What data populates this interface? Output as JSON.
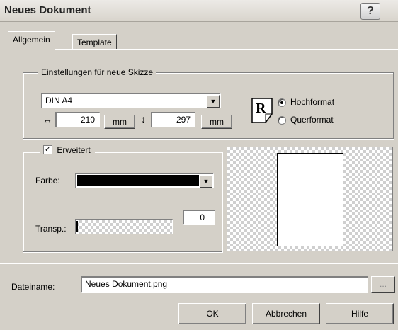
{
  "window": {
    "title": "Neues Dokument"
  },
  "tabs": [
    {
      "label": "Allgemein",
      "active": true
    },
    {
      "label": "Template",
      "active": false
    }
  ],
  "settings": {
    "legend": "Einstellungen für neue Skizze",
    "paper_size": "DIN A4",
    "width_value": "210",
    "width_unit": "mm",
    "height_value": "297",
    "height_unit": "mm",
    "orientation_icon_glyph": "R",
    "orientation": [
      {
        "label": "Hochformat",
        "checked": true
      },
      {
        "label": "Querformat",
        "checked": false
      }
    ]
  },
  "extended": {
    "label": "Erweitert",
    "checked": true,
    "color_label": "Farbe:",
    "color_value": "#000000",
    "transparency_label": "Transp.:",
    "transparency_value": "0"
  },
  "footer": {
    "filename_label": "Dateiname:",
    "filename_value": "Neues Dokument.png",
    "browse_label": "...",
    "ok_label": "OK",
    "cancel_label": "Abbrechen",
    "help_label": "Hilfe"
  },
  "titlebar_buttons": {
    "help_glyph": "?",
    "close_glyph": "✕"
  }
}
